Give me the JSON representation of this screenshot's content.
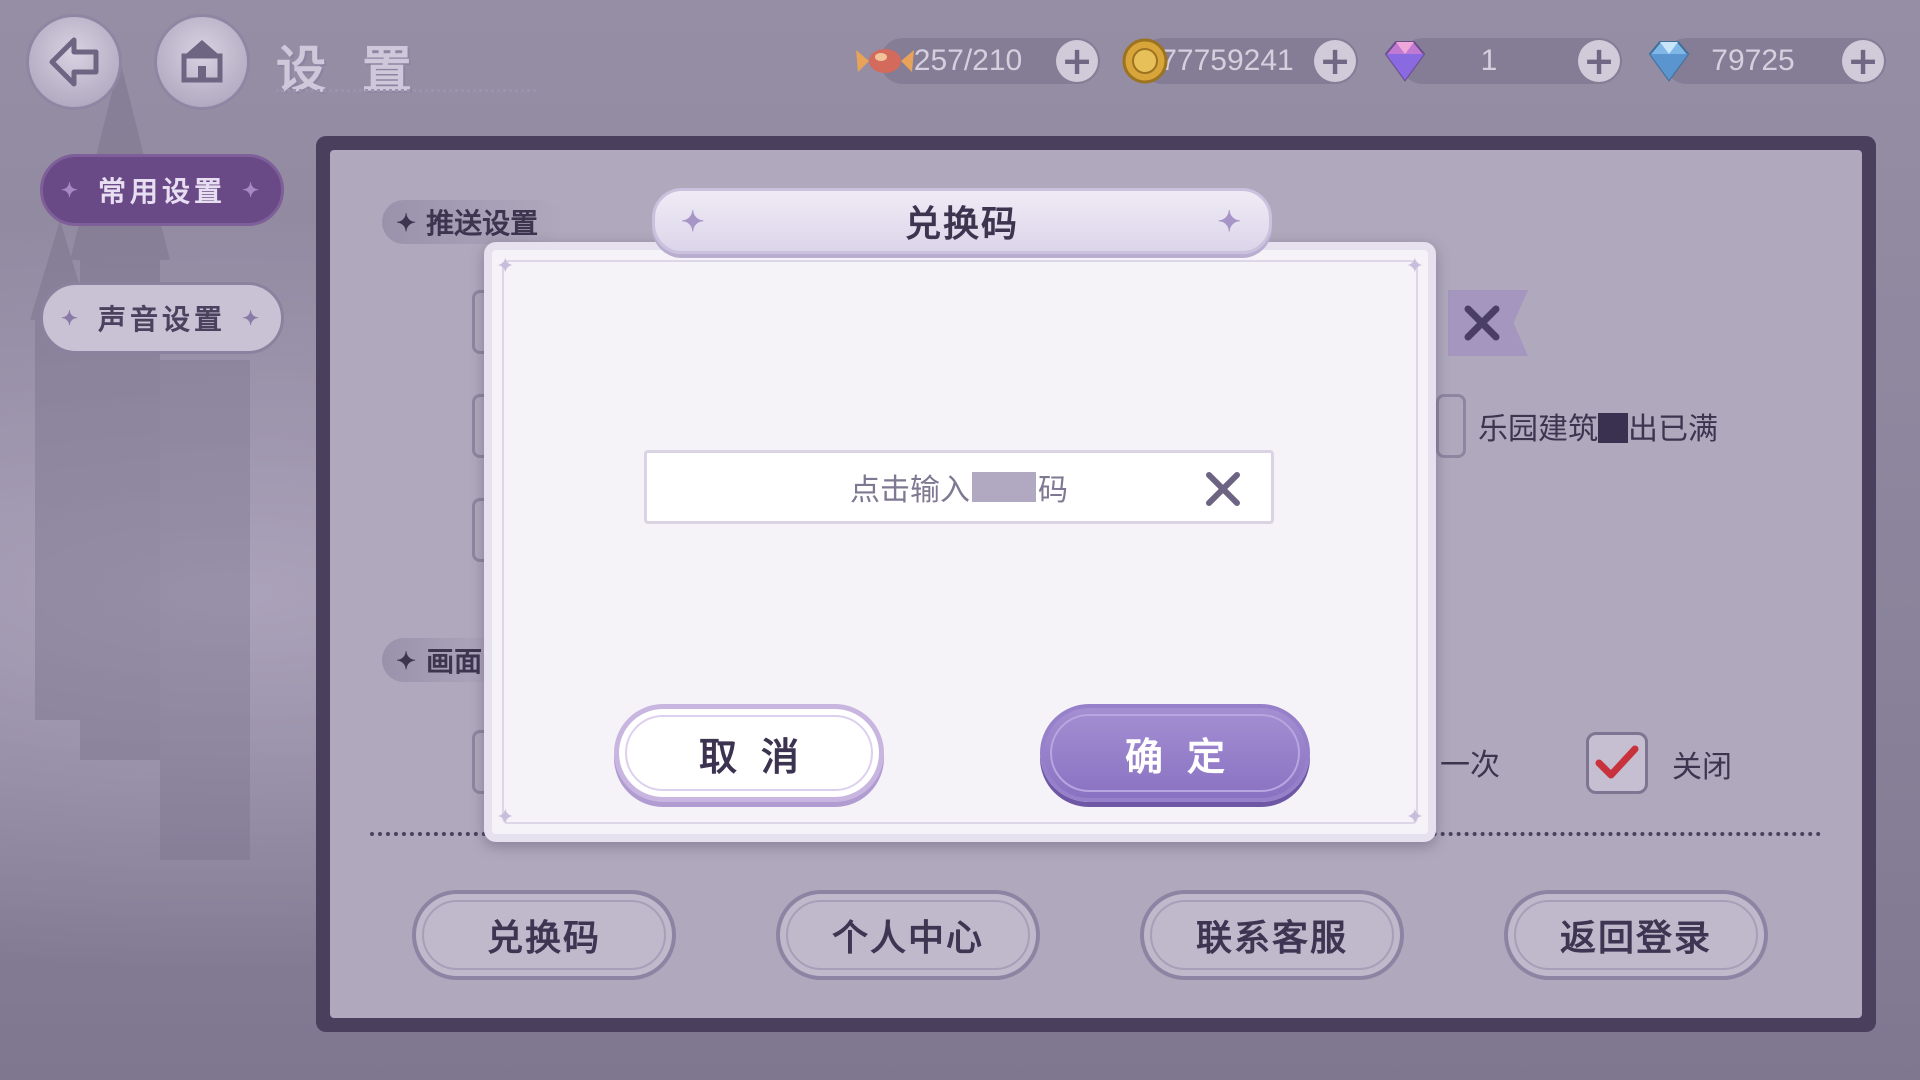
{
  "header": {
    "title": "设置",
    "resources": [
      {
        "icon": "candy-icon",
        "value": "257/210"
      },
      {
        "icon": "gold-coin-icon",
        "value": "77759241"
      },
      {
        "icon": "rainbow-gem-icon",
        "value": "1"
      },
      {
        "icon": "blue-diamond-icon",
        "value": "79725"
      }
    ]
  },
  "tabs": {
    "common": "常用设置",
    "sound": "声音设置"
  },
  "panel": {
    "push_section": "推送设置",
    "display_section_partial": "画面",
    "push_item_partial": "乐园建筑",
    "push_item_suffix": "出已满",
    "option_partial": "一次",
    "close_label": "关闭"
  },
  "bottom_buttons": {
    "redeem": "兑换码",
    "profile": "个人中心",
    "support": "联系客服",
    "back_login": "返回登录"
  },
  "dialog": {
    "title": "兑换码",
    "placeholder_prefix": "点击输入",
    "placeholder_suffix": "码",
    "cancel": "取消",
    "confirm": "确定"
  },
  "colors": {
    "accent_purple": "#8a72c2",
    "active_tab": "#6a4a86",
    "panel_border": "#4a3f5c"
  }
}
